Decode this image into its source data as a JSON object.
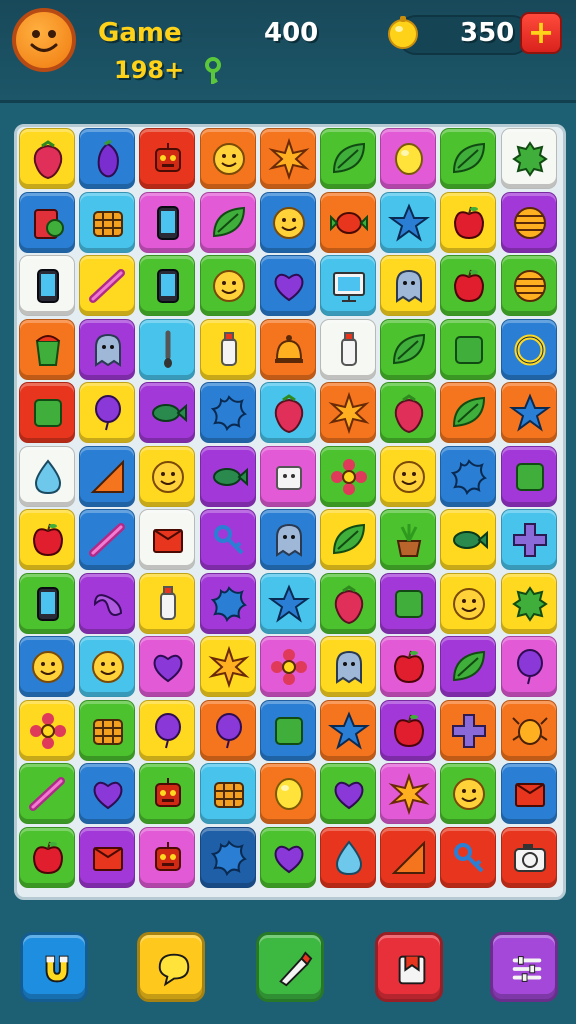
{
  "header": {
    "title": "Game",
    "subscore": "198+",
    "score": "400",
    "coins": "350",
    "plus_label": "+",
    "avatar_icon": "smiley-face-icon",
    "key_icon": "key-icon",
    "coin_icon": "gold-coin-icon"
  },
  "board": {
    "rows": 12,
    "cols": 9,
    "palette": {
      "y": "#ffd820",
      "b": "#2a7fd4",
      "o": "#f5751e",
      "r": "#e8361e",
      "g": "#4cc22e",
      "p": "#a238d8",
      "m": "#e25ad6",
      "c": "#48c4ec",
      "w": "#f6f8f4",
      "t": "#7ae2e6",
      "d": "#1f5fa8"
    },
    "tiles": [
      [
        "y:strawberry",
        "b:eggplant",
        "r:robot",
        "o:smiley",
        "o:starburst",
        "g:leaf",
        "m:lemon",
        "g:leaf",
        "w:gear"
      ],
      [
        "b:book",
        "c:basket",
        "m:phone",
        "m:leaf",
        "b:smiley",
        "o:candy",
        "c:star",
        "y:apple",
        "p:ball"
      ],
      [
        "w:phone",
        "y:stick",
        "g:phone",
        "g:smiley",
        "b:heart",
        "c:monitor",
        "y:ghost",
        "g:apple",
        "g:ball"
      ],
      [
        "o:cup",
        "p:ghost",
        "c:brush",
        "y:bottle",
        "o:bell",
        "w:bottle",
        "g:leaf",
        "g:square",
        "b:ring"
      ],
      [
        "r:square",
        "y:balloon",
        "p:fish",
        "b:splat",
        "c:strawberry",
        "o:starburst",
        "g:strawberry",
        "o:leaf",
        "o:star"
      ],
      [
        "w:drop",
        "b:triangle",
        "y:smiley",
        "p:fish",
        "m:cube",
        "g:flower",
        "y:smiley",
        "b:splat",
        "p:square"
      ],
      [
        "y:apple",
        "b:stick",
        "w:box",
        "p:key",
        "b:ghost",
        "y:leaf",
        "g:pot",
        "y:fish",
        "c:cross"
      ],
      [
        "g:phone",
        "p:knot",
        "y:bottle",
        "p:splat",
        "c:star",
        "g:strawberry",
        "p:square",
        "y:smiley",
        "y:gear"
      ],
      [
        "b:smiley",
        "c:smiley",
        "m:heart",
        "y:starburst",
        "m:flower",
        "y:ghost",
        "m:apple",
        "p:leaf",
        "m:balloon"
      ],
      [
        "y:flower",
        "g:basket",
        "y:balloon",
        "o:balloon",
        "b:square",
        "o:star",
        "p:apple",
        "o:cross",
        "o:bug"
      ],
      [
        "g:stick",
        "b:heart",
        "g:robot",
        "c:basket",
        "o:lemon",
        "g:heart",
        "m:starburst",
        "g:smiley",
        "b:box"
      ],
      [
        "g:apple",
        "p:box",
        "m:robot",
        "d:splat",
        "g:heart",
        "r:drop",
        "r:triangle",
        "r:key",
        "r:camera"
      ]
    ]
  },
  "actions": [
    {
      "name": "magnet-button",
      "icon": "magnet-icon",
      "color": "#1e8fe0"
    },
    {
      "name": "chat-button",
      "icon": "speech-bubble-icon",
      "color": "#ffc81c"
    },
    {
      "name": "hammer-button",
      "icon": "brush-icon",
      "color": "#3db840"
    },
    {
      "name": "shop-button",
      "icon": "shop-icon",
      "color": "#e8303a"
    },
    {
      "name": "settings-button",
      "icon": "sliders-icon",
      "color": "#a348d8"
    }
  ]
}
